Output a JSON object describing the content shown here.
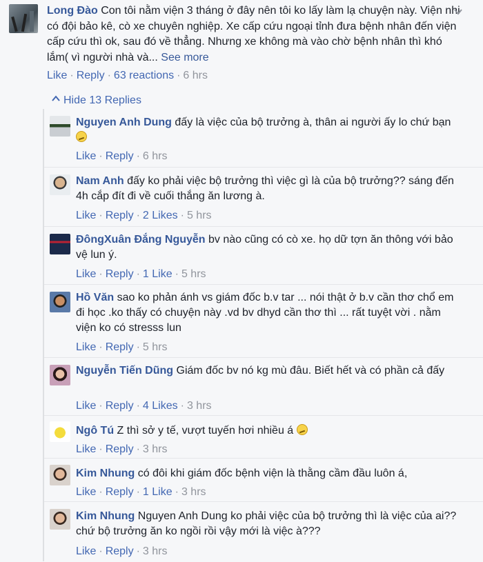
{
  "main_comment": {
    "author": "Long Đào",
    "text": "Con tôi nằm viện 3 tháng ở đây nên tôi ko lấy làm lạ chuyện này. Viện nhi có đội bảo kê, cò xe chuyên nghiệp. Xe cấp cứu ngoại tỉnh đưa bệnh nhân đến viện cấp cứu thì ok, sau đó về thẳng. Nhưng xe không mà vào chờ bệnh nhân thì khó lắm( vì người nhà và...",
    "see_more": "See more",
    "like": "Like",
    "reply": "Reply",
    "reactions": "63 reactions",
    "time": "6 hrs",
    "caret_icon": "chevron-down-icon"
  },
  "replies_toggle": {
    "label": "Hide 13 Replies",
    "icon": "arrow-up-icon"
  },
  "replies": [
    {
      "author": "Nguyen Anh Dung",
      "text": "đấy là việc của bộ trưởng à, thân ai người ấy lo chứ bạn",
      "emoji": true,
      "like": "Like",
      "reply": "Reply",
      "likes": "",
      "time": "6 hrs"
    },
    {
      "author": "Nam Anh",
      "text": "đấy ko phải việc bộ trưởng thì việc gì là của bộ trưởng?? sáng đến 4h cắp đít đi về cuối thắng ăn lương à.",
      "emoji": false,
      "like": "Like",
      "reply": "Reply",
      "likes": "2 Likes",
      "time": "5 hrs"
    },
    {
      "author": "ĐôngXuân Đắng Nguyễn",
      "text": "bv nào cũng có cò xe. họ dữ tợn ăn thông với bảo vệ lun ý.",
      "emoji": false,
      "like": "Like",
      "reply": "Reply",
      "likes": "1 Like",
      "time": "5 hrs"
    },
    {
      "author": "Hồ Văn",
      "text": "sao ko phản ánh vs giám đốc b.v tar ... nói thật ở b.v cần thơ chổ em đi học .ko thấy có chuyện này .vd bv dhyd cần thơ thì ... rất tuyệt vời . nằm viện ko có stresss lun",
      "emoji": false,
      "like": "Like",
      "reply": "Reply",
      "likes": "",
      "time": "5 hrs"
    },
    {
      "author": "Nguyễn Tiến Dũng",
      "text": "Giám đốc bv nó kg mù đâu. Biết hết và có phần cả đấy",
      "emoji": false,
      "like": "Like",
      "reply": "Reply",
      "likes": "4 Likes",
      "time": "3 hrs"
    },
    {
      "author": "Ngô Tú",
      "text": "Z thì sở y tế, vượt tuyến hơi nhiều á",
      "emoji": true,
      "like": "Like",
      "reply": "Reply",
      "likes": "",
      "time": "3 hrs"
    },
    {
      "author": "Kim Nhung",
      "text": "có đôi khi giám đốc bệnh viện là thằng cầm đầu luôn á,",
      "emoji": false,
      "like": "Like",
      "reply": "Reply",
      "likes": "1 Like",
      "time": "3 hrs"
    },
    {
      "author": "Kim Nhung",
      "text": "Nguyen Anh Dung ko phải việc của bộ trưởng thì là việc của ai??chứ bộ trưởng ăn ko ngồi rồi vậy mới là việc à???",
      "emoji": false,
      "like": "Like",
      "reply": "Reply",
      "likes": "",
      "time": "3 hrs"
    }
  ],
  "colors": {
    "link": "#4267b2",
    "author": "#365899",
    "meta": "#90949c",
    "background": "#f6f7f9"
  }
}
